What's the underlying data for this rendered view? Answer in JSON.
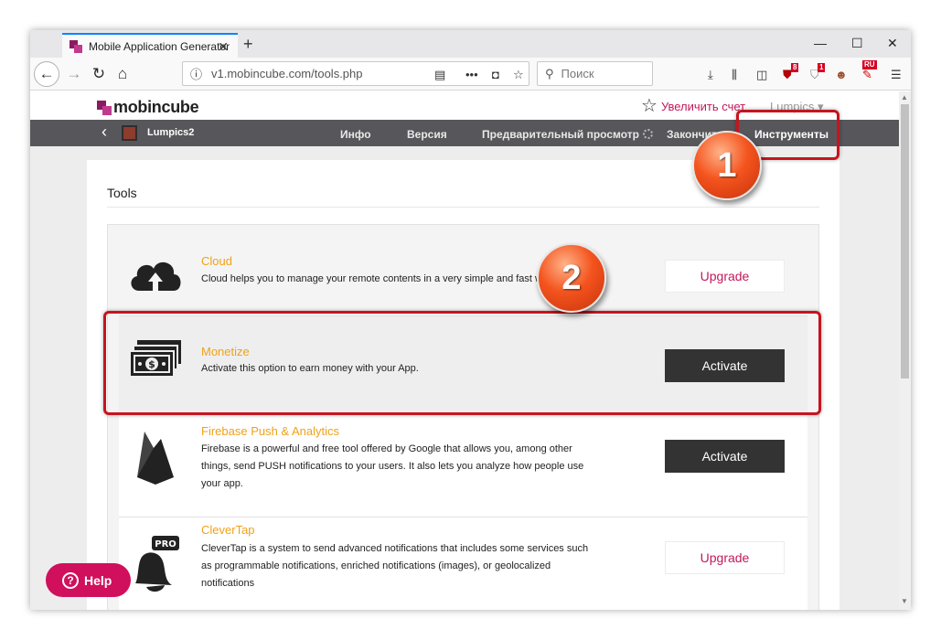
{
  "browser": {
    "tab_title": "Mobile Application Generator",
    "url": "v1.mobincube.com/tools.php",
    "search_placeholder": "Поиск",
    "ext_badges": [
      "8",
      "1",
      "RU"
    ]
  },
  "site": {
    "logo_text": "mobincube",
    "upgrade_link": "Увеличить счет",
    "user": "Lumpics",
    "app_name": "Lumpics2",
    "nav": [
      "Инфо",
      "Версия",
      "Предварительный просмотр",
      "Закончить",
      "Инструменты"
    ]
  },
  "tools": {
    "title": "Tools",
    "items": [
      {
        "name": "Cloud",
        "desc": "Cloud helps you to manage your remote contents in a very simple and fast w",
        "button": "Upgrade"
      },
      {
        "name": "Monetize",
        "desc": "Activate this option to earn money with your App.",
        "button": "Activate"
      },
      {
        "name": "Firebase Push & Analytics",
        "desc": "Firebase is a powerful and free tool offered by Google that allows you, among other things, send PUSH notifications to your users. It also lets you analyze how people use your app.",
        "button": "Activate"
      },
      {
        "name": "CleverTap",
        "desc": "CleverTap is a system to send advanced notifications that includes some services such as programmable notifications, enriched notifications (images), or geolocalized notifications",
        "button": "Upgrade"
      }
    ]
  },
  "help_label": "Help",
  "pro_badge": "PRO",
  "annotations": [
    "1",
    "2"
  ],
  "colors": {
    "accent": "#c2185b",
    "tool_name": "#f0a11a",
    "highlight": "#c5151f"
  }
}
